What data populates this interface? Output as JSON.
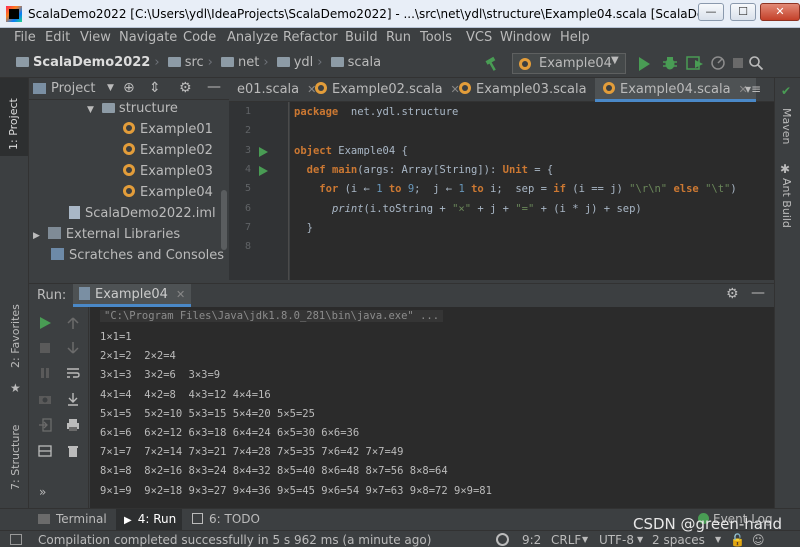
{
  "window": {
    "title": "ScalaDemo2022 [C:\\Users\\ydl\\IdeaProjects\\ScalaDemo2022] - ...\\src\\net\\ydl\\structure\\Example04.scala [ScalaDe...",
    "minimize": "—",
    "maximize": "☐",
    "close": "✕"
  },
  "menu": [
    "File",
    "Edit",
    "View",
    "Navigate",
    "Code",
    "Analyze",
    "Refactor",
    "Build",
    "Run",
    "Tools",
    "VCS",
    "Window",
    "Help"
  ],
  "breadcrumbs": [
    "ScalaDemo2022",
    "src",
    "net",
    "ydl",
    "scala"
  ],
  "run_config": "Example04",
  "project_panel": {
    "title": "Project",
    "tree": [
      {
        "label": "structure",
        "kind": "folder"
      },
      {
        "label": "Example01",
        "kind": "object"
      },
      {
        "label": "Example02",
        "kind": "object"
      },
      {
        "label": "Example03",
        "kind": "object"
      },
      {
        "label": "Example04",
        "kind": "object"
      },
      {
        "label": "ScalaDemo2022.iml",
        "kind": "file"
      },
      {
        "label": "External Libraries",
        "kind": "library"
      },
      {
        "label": "Scratches and Consoles",
        "kind": "scratch"
      }
    ]
  },
  "editor_tabs": [
    {
      "label": "e01.scala",
      "active": false
    },
    {
      "label": "Example02.scala",
      "active": false
    },
    {
      "label": "Example03.scala",
      "active": false
    },
    {
      "label": "Example04.scala",
      "active": true
    }
  ],
  "code": {
    "line_numbers": [
      "1",
      "2",
      "3",
      "4",
      "5",
      "6",
      "7",
      "8"
    ],
    "lines": [
      [
        [
          "kw",
          "package"
        ],
        [
          "",
          "  net.ydl.structure"
        ]
      ],
      [],
      [
        [
          "kw",
          "object"
        ],
        [
          "",
          " Example04 {"
        ]
      ],
      [
        [
          "",
          ""
        ],
        [
          "kw",
          "  def"
        ],
        [
          "",
          " "
        ],
        [
          "kw",
          "main"
        ],
        [
          "",
          "(args: Array["
        ],
        [
          "ty",
          "String"
        ],
        [
          "",
          "]): "
        ],
        [
          "kw",
          "Unit"
        ],
        [
          "",
          " = {"
        ]
      ],
      [
        [
          "",
          "    "
        ],
        [
          "kw",
          "for"
        ],
        [
          "",
          " (i ← "
        ],
        [
          "num",
          "1"
        ],
        [
          "",
          " "
        ],
        [
          "kw",
          "to"
        ],
        [
          "",
          " "
        ],
        [
          "num",
          "9"
        ],
        [
          "",
          ";  j ← "
        ],
        [
          "num",
          "1"
        ],
        [
          "",
          " "
        ],
        [
          "kw",
          "to"
        ],
        [
          "",
          " i;  sep = "
        ],
        [
          "kw",
          "if"
        ],
        [
          "",
          " (i == j) "
        ],
        [
          "str",
          "\"\\r\\n\""
        ],
        [
          "",
          " "
        ],
        [
          "kw",
          "else"
        ],
        [
          "",
          " "
        ],
        [
          "str",
          "\"\\t\""
        ],
        [
          "",
          ")"
        ]
      ],
      [
        [
          "",
          "      "
        ],
        [
          "it",
          "print"
        ],
        [
          "",
          "(i.toString + "
        ],
        [
          "str",
          "\"×\""
        ],
        [
          "",
          " + j + "
        ],
        [
          "str",
          "\"=\""
        ],
        [
          "",
          " + (i * j) + sep)"
        ]
      ],
      [
        [
          "",
          "  }"
        ]
      ],
      []
    ]
  },
  "run_panel": {
    "label": "Run:",
    "tab": "Example04",
    "command": "\"C:\\Program Files\\Java\\jdk1.8.0_281\\bin\\java.exe\" ...",
    "output": [
      "1×1=1",
      "2×1=2  2×2=4",
      "3×1=3  3×2=6  3×3=9",
      "4×1=4  4×2=8  4×3=12 4×4=16",
      "5×1=5  5×2=10 5×3=15 5×4=20 5×5=25",
      "6×1=6  6×2=12 6×3=18 6×4=24 6×5=30 6×6=36",
      "7×1=7  7×2=14 7×3=21 7×4=28 7×5=35 7×6=42 7×7=49",
      "8×1=8  8×2=16 8×3=24 8×4=32 8×5=40 8×6=48 8×7=56 8×8=64",
      "9×1=9  9×2=18 9×3=27 9×4=36 9×5=45 9×6=54 9×7=63 9×8=72 9×9=81"
    ]
  },
  "left_stripe": {
    "project": "1: Project",
    "favorites": "2: Favorites",
    "structure": "7: Structure"
  },
  "right_stripe": {
    "maven": "Maven",
    "ant": "Ant Build"
  },
  "bottom_tabs": [
    {
      "label": "Terminal",
      "active": false
    },
    {
      "label": "4: Run",
      "active": true
    },
    {
      "label": "6: TODO",
      "active": false
    }
  ],
  "event_log": "Event Log",
  "status": {
    "message": "Compilation completed successfully in 5 s 962 ms (a minute ago)",
    "position": "9:2",
    "line_sep": "CRLF",
    "encoding": "UTF-8",
    "indent": "2 spaces"
  },
  "watermark": "CSDN @green-hand",
  "colors": {
    "accent": "#4a88c7",
    "run_green": "#499c54",
    "keyword": "#cc7832",
    "string": "#6a8759",
    "number": "#6897bb"
  }
}
